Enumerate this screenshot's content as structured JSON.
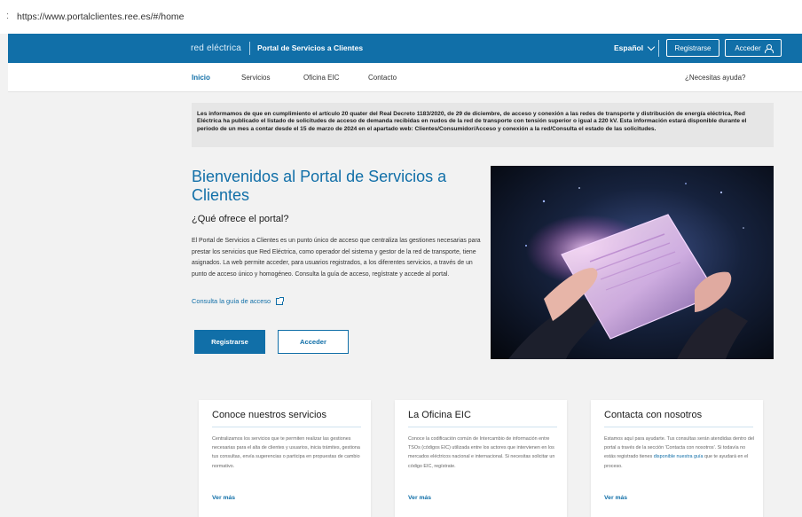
{
  "browser": {
    "url": "https://www.portalclientes.ree.es/#/home"
  },
  "header": {
    "brand": "red eléctrica",
    "portal_title": "Portal de Servicios a Clientes",
    "language": "Español",
    "register_label": "Registrarse",
    "login_label": "Acceder"
  },
  "nav": {
    "items": [
      "Inicio",
      "Servicios",
      "Oficina EIC",
      "Contacto"
    ],
    "help": "¿Necesitas ayuda?"
  },
  "notice": {
    "text": "Les informamos de que en cumplimiento el artículo 20 quater del Real Decreto 1183/2020, de 29 de diciembre, de acceso y conexión a las redes de transporte y distribución de energía eléctrica, Red Eléctrica ha publicado el listado de solicitudes de acceso de demanda recibidas en nudos de la red de transporte con tensión superior o igual a 220 kV. Esta información estará disponible durante el periodo de un mes a contar desde el 15 de marzo de 2024 en el apartado web: Clientes/Consumidor/Acceso y conexión a la red/Consulta el estado de las solicitudes."
  },
  "hero": {
    "title": "Bienvenidos al Portal de Servicios a Clientes",
    "subtitle": "¿Qué ofrece el portal?",
    "body": "El Portal de Servicios a Clientes es un punto único de acceso que centraliza las gestiones necesarias para prestar los servicios que Red Eléctrica, como operador del sistema y gestor de la red de transporte, tiene asignados. La web permite acceder, para usuarios registrados, a los diferentes servicios, a través de un punto de acceso único y homogéneo. Consulta la guía de acceso, regístrate y accede al portal.",
    "guide_link": "Consulta la guía de acceso",
    "register_button": "Registrarse",
    "login_button": "Acceder"
  },
  "cards": [
    {
      "title": "Conoce nuestros servicios",
      "text": "Centralizamos los servicios que te permiten realizar las gestiones necesarias para el alta de clientes y usuarios, inicia trámites, gestiona tus consultas, envía sugerencias o participa en propuestas de cambio normativo.",
      "more": "Ver más"
    },
    {
      "title": "La Oficina EIC",
      "text": "Conoce la codificación común de Intercambio de información entre TSOs (códigos EIC) utilizada entre los actores que intervienen en los mercados eléctricos nacional e internacional. Si necesitas solicitar un código EIC, regístrate.",
      "more": "Ver más"
    },
    {
      "title": "Contacta con nosotros",
      "text_before": "Estamos aquí para ayudarte. Tus consultas serán atendidas dentro del portal a través de la sección 'Contacta con nosotros'. Si todavía no estás registrado tienes ",
      "text_link": "disponible nuestra guía",
      "text_after": " que te ayudará en el proceso.",
      "more": "Ver más"
    }
  ],
  "colors": {
    "brand_blue": "#116fa8",
    "background": "#f2f2f2",
    "notice_bg": "#e6e6e6"
  },
  "icons": {
    "language_dropdown": "chevron-down-icon",
    "login": "user-icon",
    "guide": "external-link-icon"
  }
}
